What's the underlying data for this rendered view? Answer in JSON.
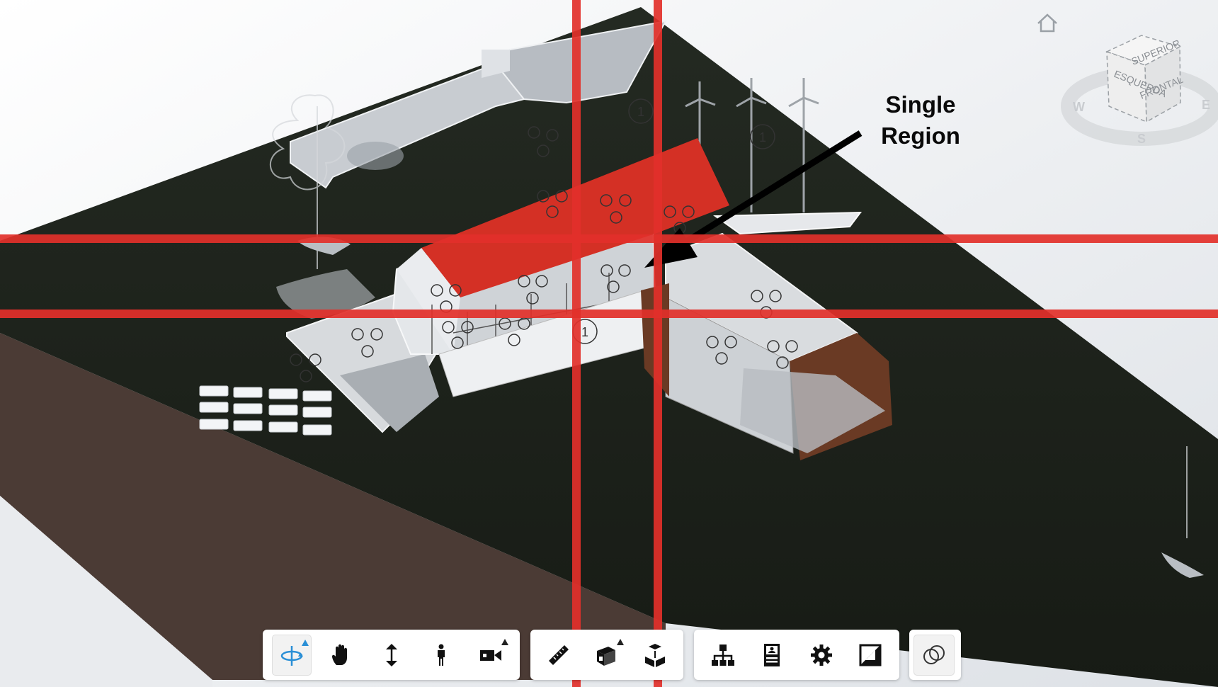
{
  "annotation": {
    "line1": "Single",
    "line2": "Region"
  },
  "viewcube": {
    "top": "SUPERIOR",
    "front": "FRONTAL",
    "left": "ESQUERDA"
  },
  "compass": {
    "west": "W",
    "east": "E",
    "south": "S"
  },
  "home_icon": "home-icon",
  "toolbar": {
    "navigation": [
      {
        "name": "orbit-tool",
        "icon": "orbit-icon",
        "active": true,
        "has_submenu": true
      },
      {
        "name": "pan-tool",
        "icon": "hand-icon",
        "active": false,
        "has_submenu": false
      },
      {
        "name": "zoom-tool",
        "icon": "vertical-arrows-icon",
        "active": false,
        "has_submenu": false
      },
      {
        "name": "first-person-tool",
        "icon": "person-icon",
        "active": false,
        "has_submenu": false
      },
      {
        "name": "camera-tool",
        "icon": "video-camera-icon",
        "active": false,
        "has_submenu": true
      }
    ],
    "analysis": [
      {
        "name": "measure-tool",
        "icon": "ruler-icon",
        "active": false
      },
      {
        "name": "section-tool",
        "icon": "section-box-icon",
        "active": false,
        "has_submenu": true
      },
      {
        "name": "explode-tool",
        "icon": "explode-cube-icon",
        "active": false
      }
    ],
    "settings": [
      {
        "name": "model-browser-tool",
        "icon": "hierarchy-icon",
        "active": false
      },
      {
        "name": "properties-tool",
        "icon": "properties-icon",
        "active": false
      },
      {
        "name": "settings-tool",
        "icon": "gear-icon",
        "active": false
      },
      {
        "name": "fullscreen-tool",
        "icon": "fullscreen-icon",
        "active": false
      }
    ],
    "extra": [
      {
        "name": "compare-tool",
        "icon": "overlap-circles-icon",
        "active": true
      }
    ]
  },
  "colors": {
    "terrain": "#1f231d",
    "soil": "#4a3a34",
    "roof": "#d43025",
    "red_grid": "#e2302a",
    "cladding": "#6a3a24",
    "orbit_active": "#2a8fd6"
  }
}
